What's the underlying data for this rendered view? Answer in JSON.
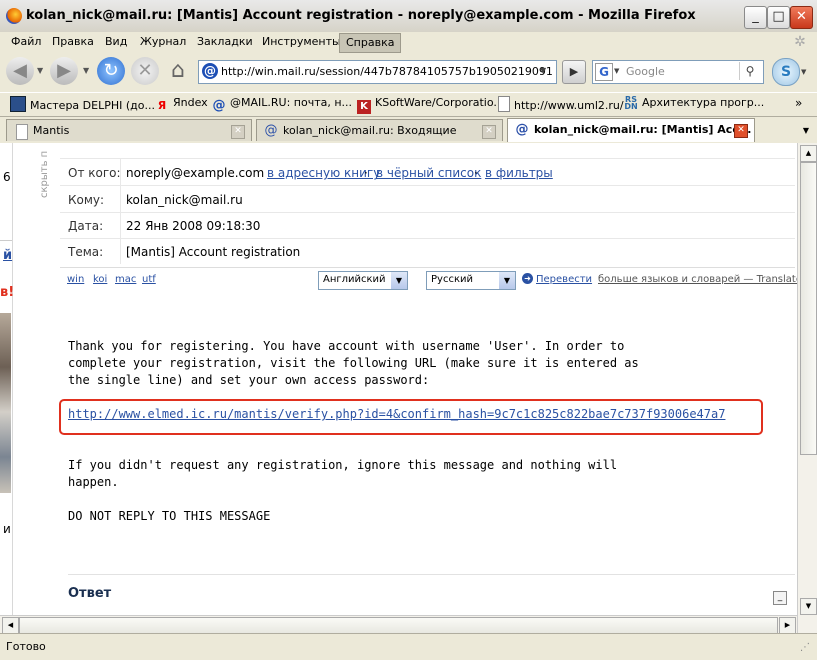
{
  "window": {
    "title": "kolan_nick@mail.ru: [Mantis] Account registration - noreply@example.com - Mozilla Firefox",
    "minimize": "_",
    "maximize": "□",
    "close": "✕"
  },
  "menu": [
    "Файл",
    "Правка",
    "Вид",
    "Журнал",
    "Закладки",
    "Инструменты",
    "Справка"
  ],
  "nav": {
    "url": "http://win.mail.ru/session/447b78784105757b19050219091d031",
    "search_placeholder": "Google"
  },
  "bookmarks": [
    {
      "label": "Мастера DELPHI (до...",
      "icon": "computer-icon"
    },
    {
      "label": "Яndex",
      "icon": "yandex-icon"
    },
    {
      "label": "@MAIL.RU: почта, н...",
      "icon": "mailru-icon"
    },
    {
      "label": "KSoftWare/Corporatio...",
      "icon": "ksoftware-icon"
    },
    {
      "label": "http://www.uml2.ru/",
      "icon": "page-icon"
    },
    {
      "label": "Архитектура прогр...",
      "icon": "rsdn-icon"
    }
  ],
  "tabs": [
    {
      "label": "Mantis"
    },
    {
      "label": "kolan_nick@mail.ru: Входящие"
    },
    {
      "label": "kolan_nick@mail.ru: [Mantis] Acc..."
    }
  ],
  "sidebar": {
    "hide_label": "скрыть п",
    "fragment_1": "6",
    "fragment_2": "й",
    "fragment_3": "в!",
    "fragment_4": "и"
  },
  "message": {
    "headers": [
      {
        "label": "От кого:",
        "value": "noreply@example.com"
      },
      {
        "label": "Кому:",
        "value": "kolan_nick@mail.ru"
      },
      {
        "label": "Дата:",
        "value": "22 Янв 2008 09:18:30"
      },
      {
        "label": "Тема:",
        "value": "[Mantis] Account registration"
      }
    ],
    "actions": [
      "в адресную книгу",
      "в чёрный список",
      "в фильтры"
    ],
    "encodings": [
      "win",
      "koi",
      "mac",
      "utf"
    ],
    "translate": {
      "from": "Английский",
      "to": "Русский",
      "button": "Перевести",
      "more": "больше языков и словарей — Translate.ru"
    },
    "body_lines": [
      "Thank you for registering. You have account with username 'User'. In order to",
      "complete your registration, visit the following URL (make sure it is entered as",
      "the single line) and set your own access password:"
    ],
    "verify_link": "http://www.elmed.ic.ru/mantis/verify.php?id=4&confirm_hash=9c7c1c825c822bae7c737f93006e47a7",
    "body_lines_2": [
      "If you didn't request any registration, ignore this message and nothing will",
      "happen."
    ],
    "footer_line": "DO NOT REPLY TO THIS MESSAGE",
    "reply_title": "Ответ"
  },
  "status": {
    "text": "Готово"
  },
  "colors": {
    "link": "#2a51a3",
    "highlight_box": "#e0301e"
  }
}
